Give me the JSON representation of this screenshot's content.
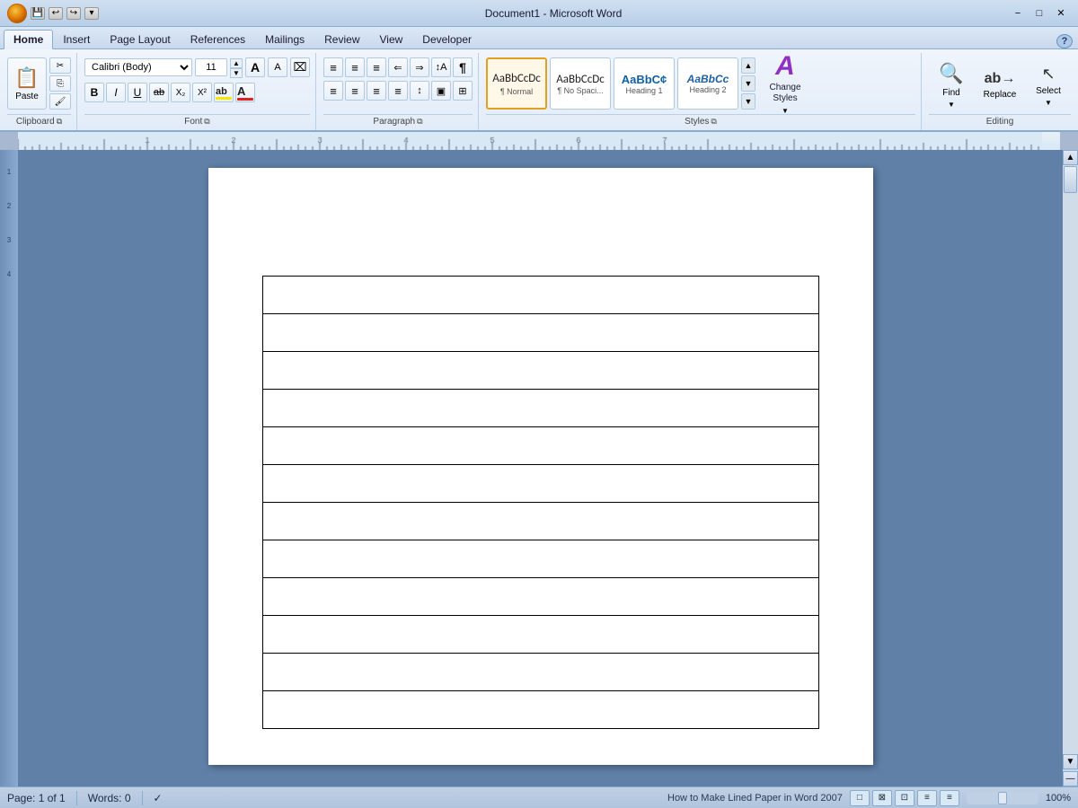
{
  "titlebar": {
    "title": "Document1 - Microsoft Word",
    "minimize": "−",
    "maximize": "□",
    "close": "✕"
  },
  "quickaccess": {
    "save": "💾",
    "undo": "↩",
    "redo": "↪",
    "dropdown": "▼"
  },
  "tabs": [
    {
      "id": "home",
      "label": "Home",
      "active": true
    },
    {
      "id": "insert",
      "label": "Insert",
      "active": false
    },
    {
      "id": "pagelayout",
      "label": "Page Layout",
      "active": false
    },
    {
      "id": "references",
      "label": "References",
      "active": false
    },
    {
      "id": "mailings",
      "label": "Mailings",
      "active": false
    },
    {
      "id": "review",
      "label": "Review",
      "active": false
    },
    {
      "id": "view",
      "label": "View",
      "active": false
    },
    {
      "id": "developer",
      "label": "Developer",
      "active": false
    }
  ],
  "clipboard": {
    "paste_label": "Paste",
    "cut_label": "Cut",
    "copy_label": "Copy",
    "formatpainter_label": "Format Painter",
    "group_label": "Clipboard"
  },
  "font": {
    "name": "Calibri (Body)",
    "size": "11",
    "bold": "B",
    "italic": "I",
    "underline": "U",
    "strikethrough": "ab",
    "subscript": "X₂",
    "superscript": "X²",
    "clearformat": "A",
    "fontcolor": "A",
    "highlight": "ab",
    "group_label": "Font",
    "grow": "A",
    "shrink": "A"
  },
  "paragraph": {
    "bullets": "≡",
    "numbering": "≡",
    "multilevel": "≡",
    "decrease_indent": "⇐",
    "increase_indent": "⇒",
    "sort": "↕",
    "show_marks": "¶",
    "align_left": "≡",
    "align_center": "≡",
    "align_right": "≡",
    "justify": "≡",
    "line_spacing": "≡",
    "shading": "□",
    "borders": "⊞",
    "group_label": "Paragraph"
  },
  "styles": {
    "items": [
      {
        "id": "normal",
        "preview": "AaBbCcDc",
        "label": "¶ Normal",
        "active": true
      },
      {
        "id": "nospacing",
        "preview": "AaBbCcDc",
        "label": "¶ No Spaci...",
        "active": false
      },
      {
        "id": "heading1",
        "preview": "AaBbC¢",
        "label": "Heading 1",
        "active": false
      },
      {
        "id": "heading2",
        "preview": "AaBbCc",
        "label": "Heading 2",
        "active": false
      }
    ],
    "scroll_up": "▲",
    "scroll_down": "▼",
    "more": "▼",
    "group_label": "Styles"
  },
  "change_styles": {
    "label": "Change Styles",
    "icon": "A"
  },
  "editing": {
    "find_label": "Find",
    "replace_label": "Replace",
    "select_label": "Select",
    "group_label": "Editing",
    "find_icon": "🔍",
    "replace_icon": "ab",
    "select_icon": "↖"
  },
  "statusbar": {
    "page": "Page: 1 of 1",
    "words": "Words: 0",
    "proofing_icon": "✓",
    "layout_icon": "□",
    "status_text": "How to Make Lined Paper in Word 2007"
  },
  "document": {
    "table_rows": 12,
    "table_cols": 1
  }
}
